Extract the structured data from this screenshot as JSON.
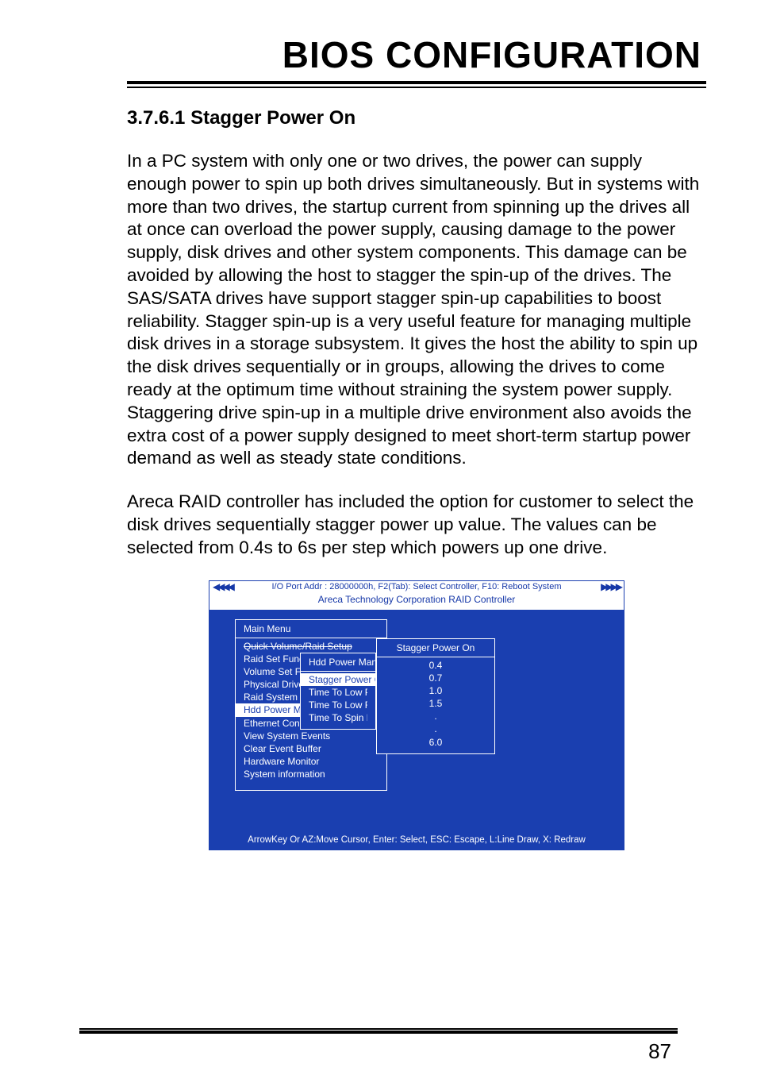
{
  "chapter": {
    "title": "BIOS CONFIGURATION"
  },
  "section": {
    "heading": "3.7.6.1 Stagger Power On"
  },
  "paragraphs": {
    "p1": "In a PC system with only one or two drives, the power can supply enough power to spin up both drives simultaneously. But in systems with more than two drives, the startup current from spinning up the drives all at once can overload the power supply, causing damage to the power supply, disk drives and other system components. This damage can be avoided by allowing the host to stagger the spin-up of the drives. The SAS/SATA drives have support stagger spin-up capabilities to boost reliability. Stagger spin-up is a very useful feature for managing multiple disk drives in a storage subsystem. It gives the host the ability to spin up the disk drives sequentially or in groups, allowing the drives to come ready at the optimum time without straining the system power supply. Staggering drive spin-up in a multiple drive environment also avoids the extra cost of a power supply designed to meet short-term startup power demand as well as steady state conditions.",
    "p2": "Areca RAID controller has included the option for customer to select the disk drives sequentially stagger power up value. The values can be selected from 0.4s to 6s per step which powers up one drive."
  },
  "bios": {
    "top_bar": "I/O Port Addr : 28000000h, F2(Tab): Select Controller, F10: Reboot System",
    "arrows_left": "◀◀◀◀",
    "arrows_right": "▶▶▶▶",
    "sub_bar": "Areca Technology Corporation RAID Controller",
    "main_menu": {
      "title": "Main Menu",
      "items": {
        "i0": "Quick Volume/Raid Setup",
        "i1": "Raid Set Function",
        "i2": "Volume Set Function",
        "i3": "Physical Drives",
        "i4": "Raid System Function",
        "i5": "Hdd Power Management",
        "i6": "Ethernet Configuration",
        "i7": "View System Events",
        "i8": "Clear Event Buffer",
        "i9": "Hardware Monitor",
        "i10": "System information"
      }
    },
    "sub_menu": {
      "title": "Hdd Power Management",
      "items": {
        "i0": "Stagger Power On",
        "i1": "Time To Low Power Idle",
        "i2": "Time To Low RPM Mode",
        "i3": "Time To Spin Down Hdd"
      }
    },
    "popup": {
      "title": "Stagger Power On",
      "items": {
        "i0": "0.4",
        "i1": "0.7",
        "i2": "1.0",
        "i3": "1.5",
        "i4": ".",
        "i5": ".",
        "i6": "6.0"
      }
    },
    "foot": "ArrowKey Or AZ:Move Cursor, Enter: Select, ESC: Escape, L:Line Draw, X: Redraw"
  },
  "page_number": "87"
}
